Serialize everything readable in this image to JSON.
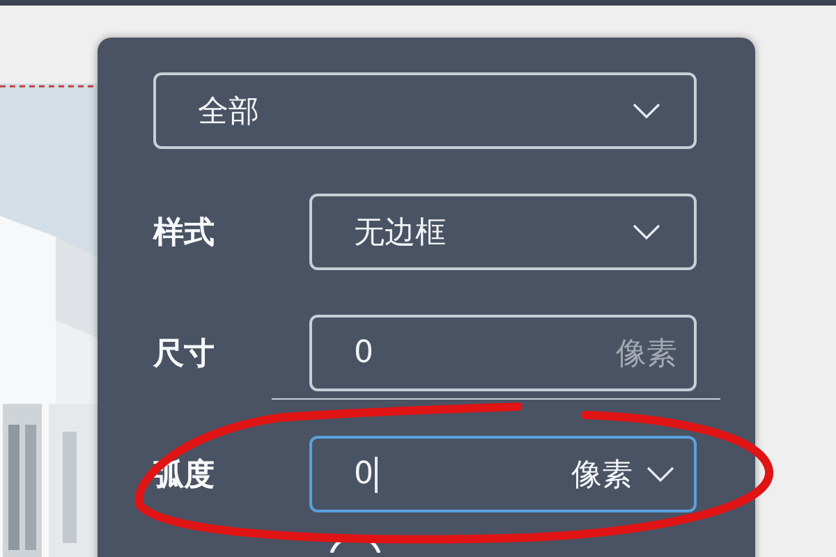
{
  "scope_select": {
    "value": "全部"
  },
  "rows": [
    {
      "kind": "select",
      "label": "样式",
      "value": "无边框"
    },
    {
      "kind": "input",
      "label": "尺寸",
      "value": "0",
      "unit": "像素",
      "focused": false
    },
    {
      "kind": "input_select",
      "label": "弧度",
      "value": "0",
      "unit": "像素",
      "focused": true
    }
  ]
}
